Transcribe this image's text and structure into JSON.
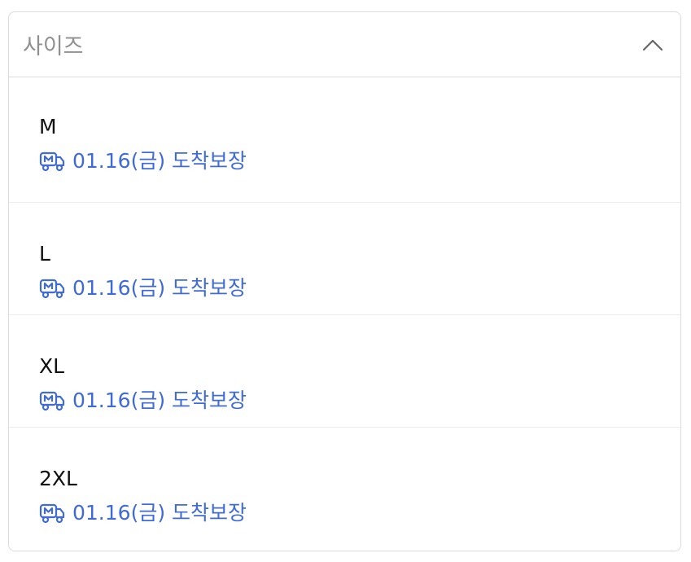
{
  "header": {
    "title": "사이즈",
    "toggle_icon": "chevron-up-icon"
  },
  "colors": {
    "delivery_text": "#3f6ad8",
    "border": "#dcdcdc",
    "title_text": "#8f8f8f"
  },
  "options": [
    {
      "name": "M",
      "delivery_icon": "delivery-truck-icon",
      "delivery_text": "01.16(금) 도착보장"
    },
    {
      "name": "L",
      "delivery_icon": "delivery-truck-icon",
      "delivery_text": "01.16(금) 도착보장"
    },
    {
      "name": "XL",
      "delivery_icon": "delivery-truck-icon",
      "delivery_text": "01.16(금) 도착보장"
    },
    {
      "name": "2XL",
      "delivery_icon": "delivery-truck-icon",
      "delivery_text": "01.16(금) 도착보장"
    }
  ]
}
